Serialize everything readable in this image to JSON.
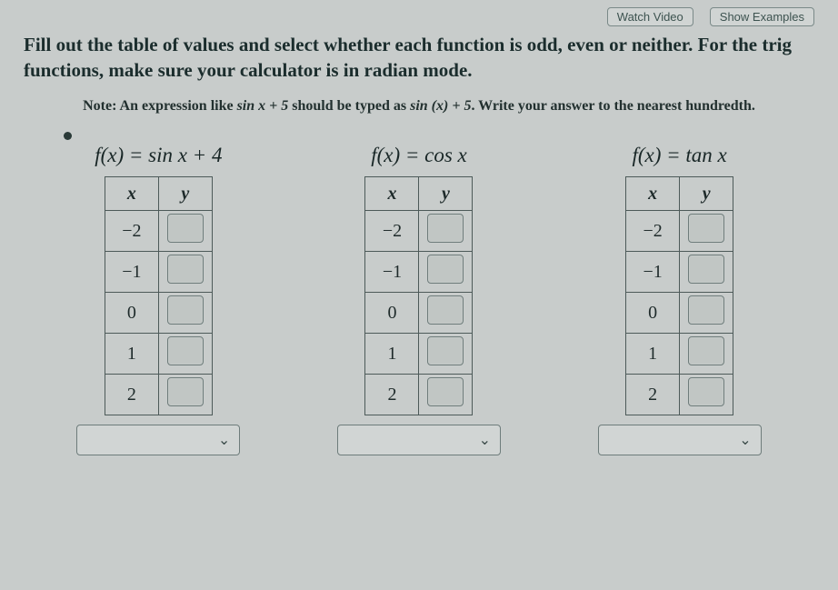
{
  "top_buttons": {
    "watch": "Watch Video",
    "examples": "Show Examples"
  },
  "instructions": "Fill out the table of values and select whether each function is odd, even or neither. For the trig functions, make sure your calculator is in radian mode.",
  "note_prefix": "Note: An expression like ",
  "note_expr1": "sin x + 5",
  "note_mid": " should be typed as ",
  "note_expr2": "sin (x) + 5",
  "note_suffix": ". Write your answer to the nearest hundredth.",
  "headers": {
    "x": "x",
    "y": "y"
  },
  "x_values": [
    "−2",
    "−1",
    "0",
    "1",
    "2"
  ],
  "functions": [
    {
      "title_lhs": "f(x) = ",
      "title_rhs": "sin x + 4",
      "parity_placeholder": ""
    },
    {
      "title_lhs": "f(x) = ",
      "title_rhs": "cos x",
      "parity_placeholder": ""
    },
    {
      "title_lhs": "f(x) = ",
      "title_rhs": "tan x",
      "parity_placeholder": ""
    }
  ],
  "chevron": "⌄"
}
